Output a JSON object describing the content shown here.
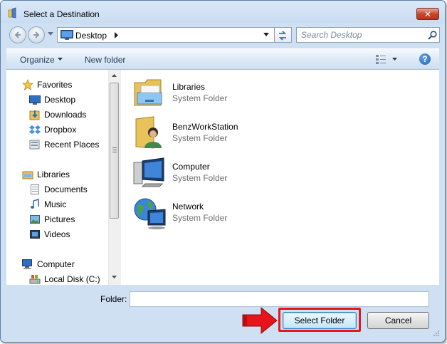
{
  "window": {
    "title": "Select a Destination",
    "close_symbol": "✕"
  },
  "address_bar": {
    "location": "Desktop",
    "search_placeholder": "Search Desktop"
  },
  "toolbar": {
    "organize": "Organize",
    "new_folder": "New folder",
    "help_symbol": "?"
  },
  "nav_pane": {
    "favorites_header": "Favorites",
    "favorites": [
      "Desktop",
      "Downloads",
      "Dropbox",
      "Recent Places"
    ],
    "libraries_header": "Libraries",
    "libraries": [
      "Documents",
      "Music",
      "Pictures",
      "Videos"
    ],
    "computer_header": "Computer",
    "computer": [
      "Local Disk (C:)"
    ]
  },
  "content": {
    "items": [
      {
        "name": "Libraries",
        "type": "System Folder",
        "icon": "libraries-icon"
      },
      {
        "name": "BenzWorkStation",
        "type": "System Folder",
        "icon": "user-folder-icon"
      },
      {
        "name": "Computer",
        "type": "System Folder",
        "icon": "computer-icon"
      },
      {
        "name": "Network",
        "type": "System Folder",
        "icon": "network-icon"
      }
    ]
  },
  "footer": {
    "folder_label": "Folder:",
    "folder_value": "",
    "select_button": "Select Folder",
    "cancel_button": "Cancel"
  },
  "colors": {
    "accent_highlight": "#e6141b",
    "window_frame": "#cfe0f3"
  }
}
